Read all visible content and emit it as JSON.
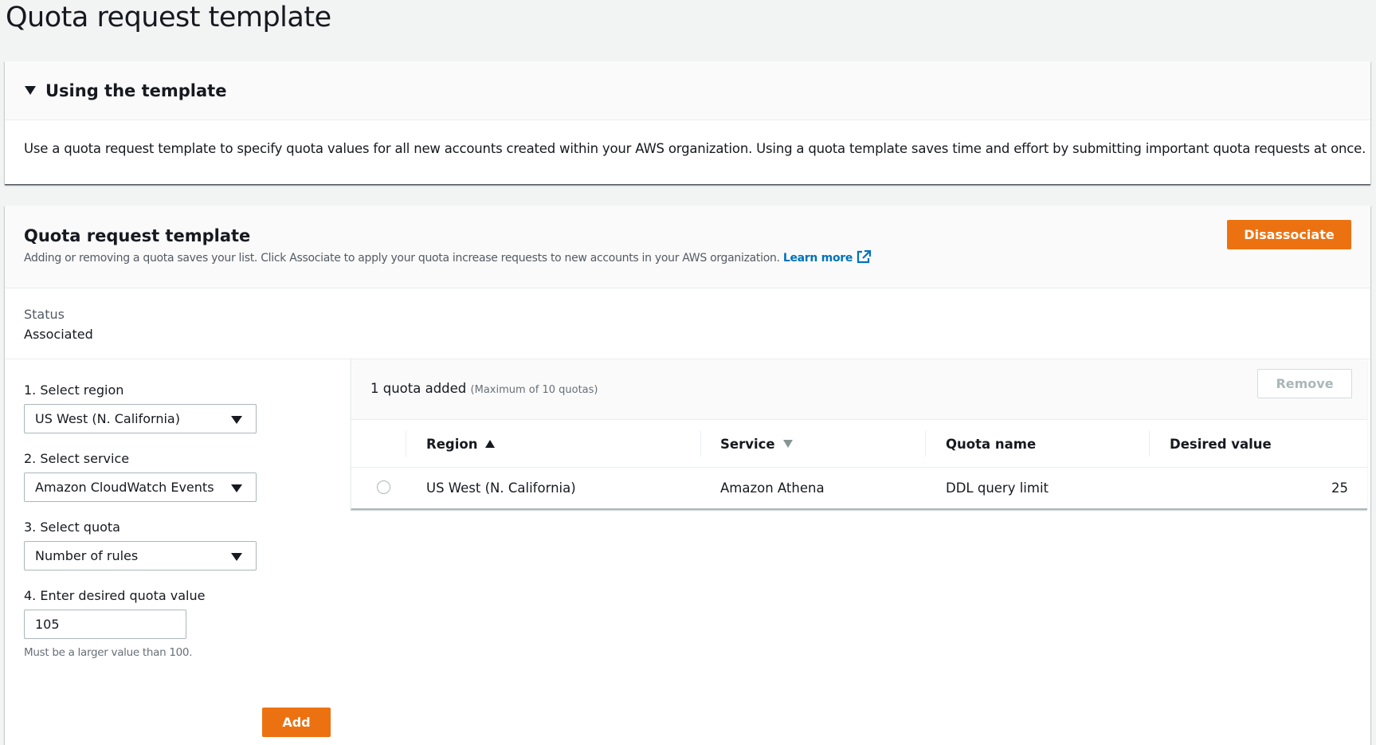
{
  "page": {
    "title": "Quota request template"
  },
  "info_panel": {
    "header": "Using the template",
    "body": "Use a quota request template to specify quota values for all new accounts created within your AWS organization. Using a quota template saves time and effort by submitting important quota requests at once."
  },
  "template_panel": {
    "title": "Quota request template",
    "description": "Adding or removing a quota saves your list. Click Associate to apply your quota increase requests to new accounts in your AWS organization.",
    "learn_more": "Learn more",
    "disassociate_label": "Disassociate",
    "status_label": "Status",
    "status_value": "Associated"
  },
  "form": {
    "region_label": "1. Select region",
    "region_value": "US West (N. California)",
    "service_label": "2. Select service",
    "service_value": "Amazon CloudWatch Events",
    "quota_label": "3. Select quota",
    "quota_value": "Number of rules",
    "value_label": "4. Enter desired quota value",
    "value_input": "105",
    "hint": "Must be a larger value than 100.",
    "add_label": "Add"
  },
  "quota_table": {
    "count_text": "1 quota added",
    "max_text": "(Maximum of 10 quotas)",
    "remove_label": "Remove",
    "columns": [
      "Region",
      "Service",
      "Quota name",
      "Desired value"
    ],
    "rows": [
      {
        "region": "US West (N. California)",
        "service": "Amazon Athena",
        "quota_name": "DDL query limit",
        "desired_value": "25"
      }
    ]
  },
  "colors": {
    "primary": "#ec7211",
    "link": "#0073bb",
    "background": "#f2f3f3"
  },
  "icons": [
    "caret-down-icon",
    "external-link-icon",
    "dropdown-arrow-icon",
    "sort-ascending-icon",
    "sort-descending-icon",
    "radio-icon"
  ]
}
